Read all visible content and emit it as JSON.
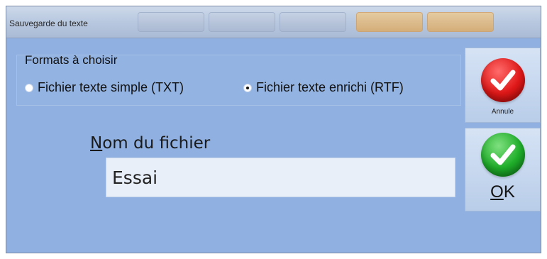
{
  "window": {
    "title": "Sauvegarde du texte"
  },
  "formats": {
    "label": "Formats à choisir",
    "options": [
      {
        "label": "Fichier texte simple (TXT)",
        "checked": false
      },
      {
        "label": "Fichier texte enrichi (RTF)",
        "checked": true
      }
    ]
  },
  "filename": {
    "label_first": "N",
    "label_rest": "om du fichier",
    "value": "Essai"
  },
  "buttons": {
    "cancel_label": "Annule",
    "ok_label_first": "O",
    "ok_label_rest": "K"
  },
  "colors": {
    "background": "#8fb0e0",
    "cancel_icon": "#e01818",
    "ok_icon": "#1fae2a"
  },
  "icons": {
    "cancel": "red-check-icon",
    "ok": "green-check-icon"
  }
}
